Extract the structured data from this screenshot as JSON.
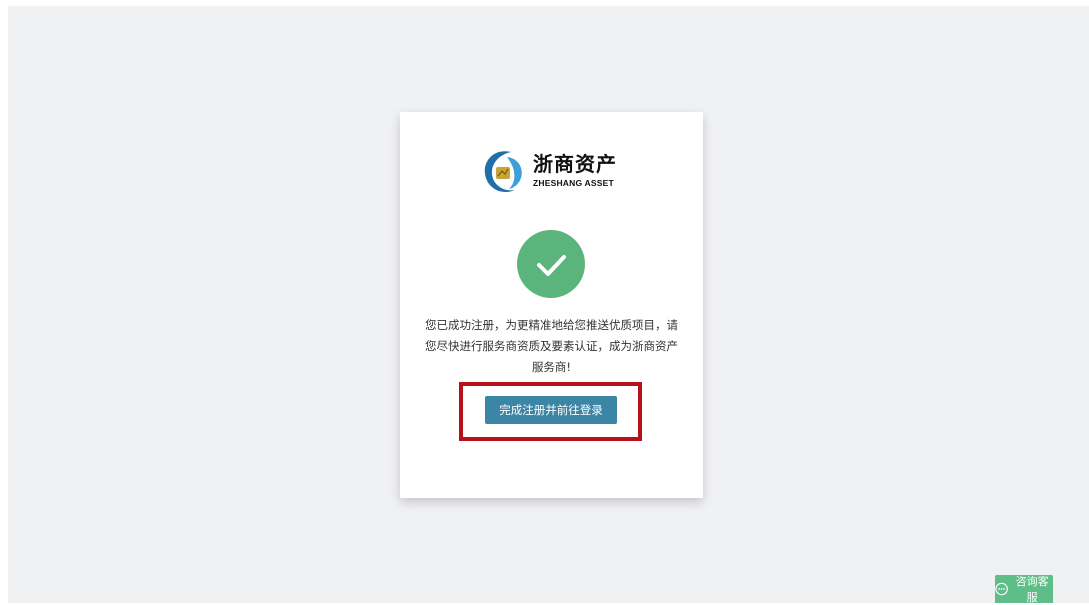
{
  "brand": {
    "name_cn": "浙商资产",
    "name_en": "ZHESHANG ASSET",
    "colors": {
      "brand_blue": "#1f6fa8",
      "success_green": "#5bb47c",
      "button_blue": "#3b85a5",
      "highlight_red": "#b5121b",
      "support_green": "#5fbe87"
    }
  },
  "result": {
    "icon": "check-circle-icon",
    "message": "您已成功注册，为更精准地给您推送优质项目，请您尽快进行服务商资质及要素认证，成为浙商资产服务商!"
  },
  "actions": {
    "complete_label": "完成注册并前往登录"
  },
  "support": {
    "icon": "chat-bubble-icon",
    "label": "咨询客服"
  }
}
